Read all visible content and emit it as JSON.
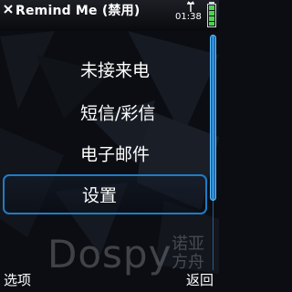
{
  "status": {
    "title": "Remind Me (禁用)",
    "time": "01:38"
  },
  "menu": {
    "items": [
      {
        "label": "未接来电"
      },
      {
        "label": "短信/彩信"
      },
      {
        "label": "电子邮件"
      },
      {
        "label": "设置",
        "selected": true
      }
    ]
  },
  "watermark": {
    "brand": "Dospy",
    "chinese": "诺亚方舟"
  },
  "softkeys": {
    "left": "选项",
    "right": "返回"
  },
  "colors": {
    "accent": "#1d7dc8",
    "background": "#0b0d12"
  }
}
